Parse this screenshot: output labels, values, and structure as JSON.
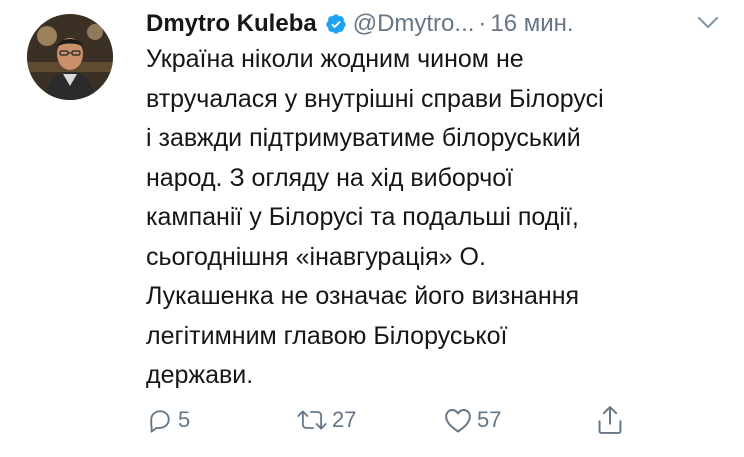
{
  "author": {
    "display_name": "Dmytro Kuleba",
    "handle": "@Dmytro...",
    "separator": "·",
    "time": "16 мин.",
    "verified": true,
    "avatar_icon": "profile-photo"
  },
  "tweet": {
    "lines": [
      "Україна ніколи жодним чином не",
      "втручалася у внутрішні справи Білорусі",
      "і завжди підтримуватиме білоруський",
      "народ. З огляду на хід виборчої",
      "кампанії у Білорусі та подальші події,",
      "сьогоднішня «інавгурація» О.",
      "Лукашенка не означає його визнання",
      "легітимним главою Білоруської",
      "держави."
    ]
  },
  "actions": {
    "reply_count": "5",
    "retweet_count": "27",
    "like_count": "57"
  },
  "colors": {
    "text": "#14171a",
    "secondary": "#657786",
    "verified": "#1da1f2"
  }
}
